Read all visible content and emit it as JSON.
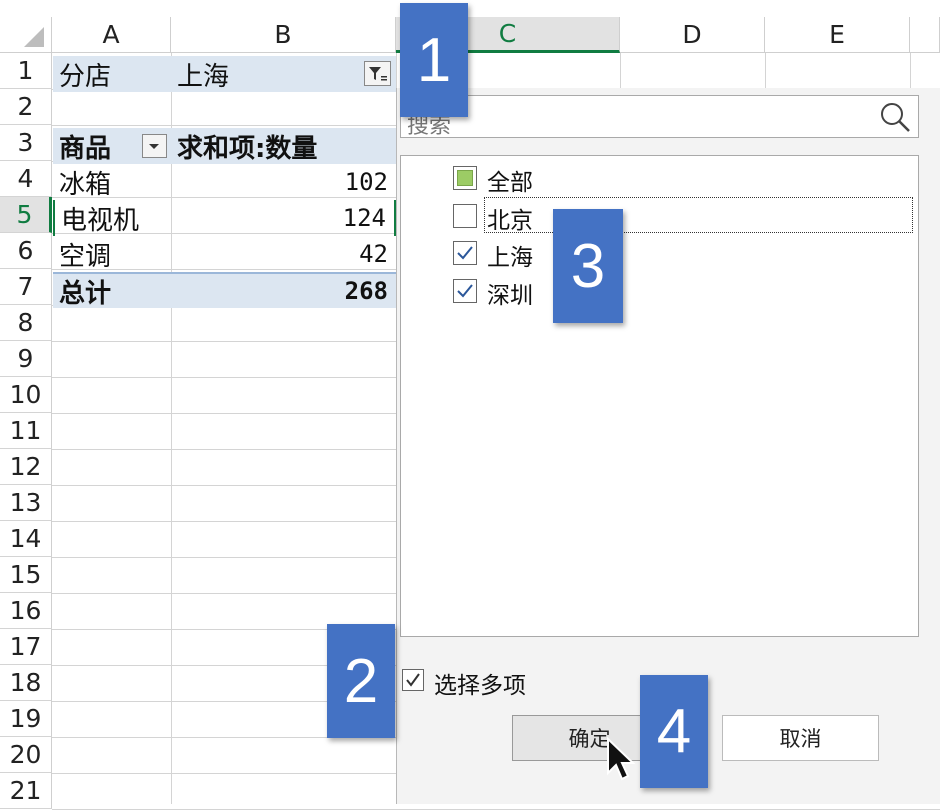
{
  "columns": [
    "A",
    "B",
    "C",
    "D",
    "E"
  ],
  "rows": [
    "1",
    "2",
    "3",
    "4",
    "5",
    "6",
    "7",
    "8",
    "9",
    "10",
    "11",
    "12",
    "13",
    "14",
    "15",
    "16",
    "17",
    "18",
    "19",
    "20",
    "21"
  ],
  "pivot": {
    "filter_label": "分店",
    "filter_value": "上海",
    "header_product": "商品",
    "header_sum": "求和项:数量",
    "items": [
      {
        "name": "冰箱",
        "value": "102"
      },
      {
        "name": "电视机",
        "value": "124"
      },
      {
        "name": "空调",
        "value": "42"
      }
    ],
    "total_label": "总计",
    "total_value": "268"
  },
  "filter_panel": {
    "search_placeholder": "搜索",
    "options": [
      {
        "label": "全部",
        "state": "partial"
      },
      {
        "label": "北京",
        "state": "unchecked"
      },
      {
        "label": "上海",
        "state": "checked"
      },
      {
        "label": "深圳",
        "state": "checked"
      }
    ],
    "multi_select_label": "选择多项",
    "multi_select_checked": true,
    "ok_label": "确定",
    "cancel_label": "取消"
  },
  "badges": {
    "b1": "1",
    "b2": "2",
    "b3": "3",
    "b4": "4"
  },
  "colors": {
    "accent_blue": "#4472c4",
    "pivot_band": "#dce6f1",
    "selected_col": "#107c41"
  },
  "icons": {
    "filter_button": "filter-icon",
    "dropdown": "chevron-down-icon",
    "search": "search-icon",
    "cursor": "mouse-pointer-icon"
  }
}
